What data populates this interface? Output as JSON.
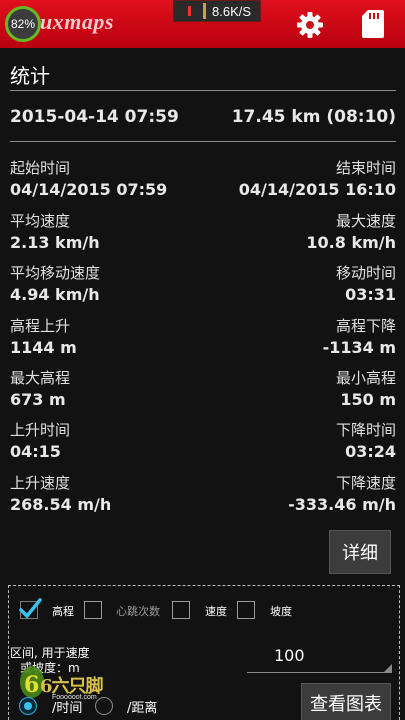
{
  "status": {
    "battery": "82%",
    "net_speed": "8.6K/S"
  },
  "app": {
    "logo": "uxmaps"
  },
  "page": {
    "title": "统计"
  },
  "summary": {
    "datetime": "2015-04-14 07:59",
    "distance_duration": "17.45 km (08:10)"
  },
  "stats": [
    {
      "left_label": "起始时间",
      "left_value": "04/14/2015 07:59",
      "right_label": "结束时间",
      "right_value": "04/14/2015 16:10"
    },
    {
      "left_label": "平均速度",
      "left_value": "2.13 km/h",
      "right_label": "最大速度",
      "right_value": "10.8 km/h"
    },
    {
      "left_label": "平均移动速度",
      "left_value": "4.94 km/h",
      "right_label": "移动时间",
      "right_value": "03:31"
    },
    {
      "left_label": "高程上升",
      "left_value": "1144 m",
      "right_label": "高程下降",
      "right_value": "-1134 m"
    },
    {
      "left_label": "最大高程",
      "left_value": "673 m",
      "right_label": "最小高程",
      "right_value": "150 m"
    },
    {
      "left_label": "上升时间",
      "left_value": "04:15",
      "right_label": "下降时间",
      "right_value": "03:24"
    },
    {
      "left_label": "上升速度",
      "left_value": "268.54 m/h",
      "right_label": "下降速度",
      "right_value": "-333.46 m/h"
    }
  ],
  "buttons": {
    "detail": "详细",
    "view_chart": "查看图表"
  },
  "chart_options": {
    "checkboxes": [
      {
        "label": "高程",
        "checked": true
      },
      {
        "label": "心跳次数",
        "checked": false
      },
      {
        "label": "速度",
        "checked": false
      },
      {
        "label": "坡度",
        "checked": false
      }
    ],
    "interval_label_line1": "区间, 用于速度",
    "interval_label_line2": "或坡度：m",
    "interval_value": "100",
    "radio": [
      {
        "label": "/时间",
        "selected": true
      },
      {
        "label": "/距离",
        "selected": false
      }
    ]
  },
  "watermark": {
    "text": "6六只脚",
    "sub": "Foooooot.com"
  },
  "colors": {
    "app_bar": "#d0101c",
    "background": "#121212",
    "checkbox_accent": "#36c3f0"
  }
}
